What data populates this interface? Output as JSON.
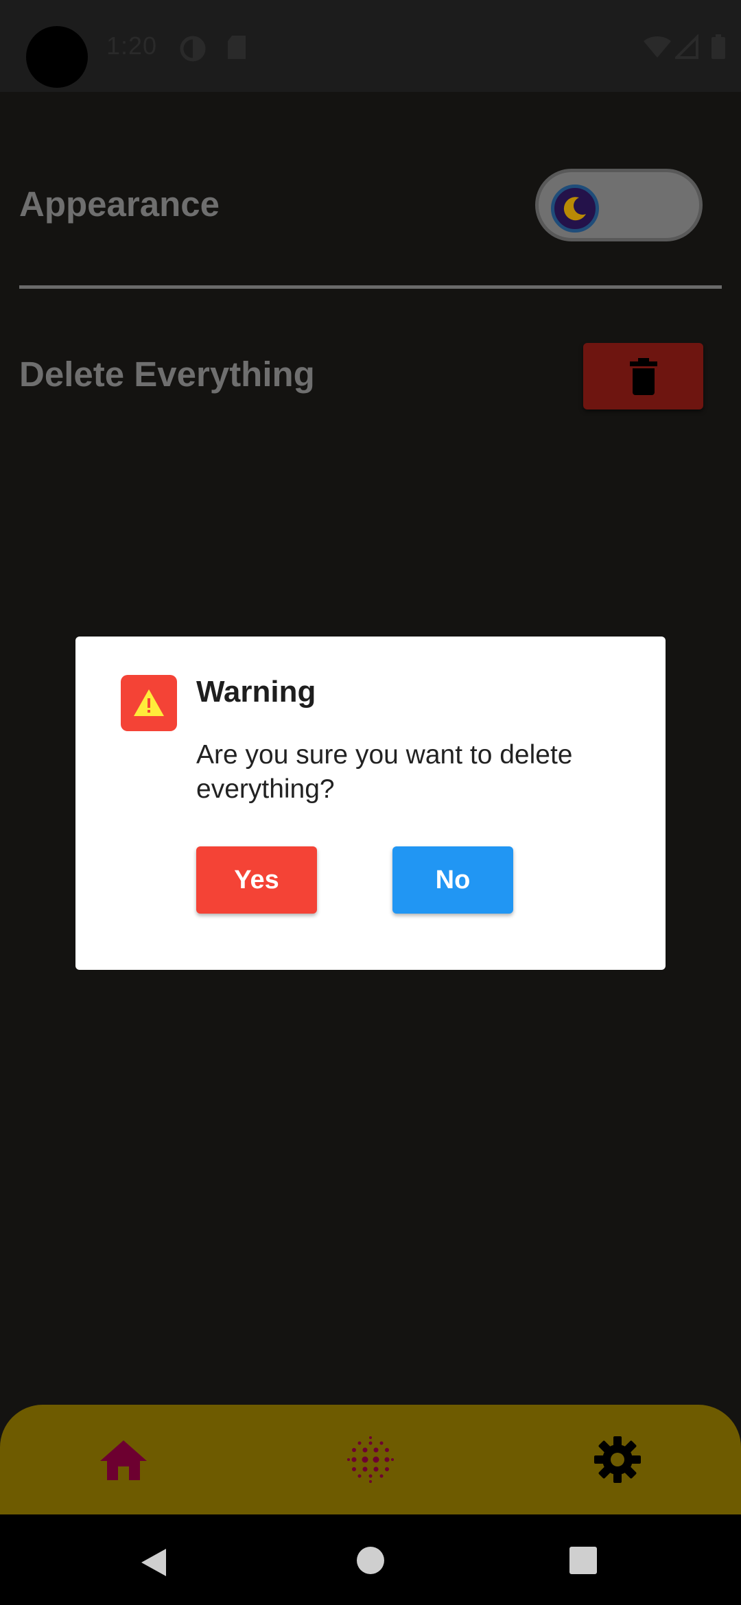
{
  "status_bar": {
    "time": "1:20"
  },
  "settings": {
    "appearance_label": "Appearance",
    "delete_label": "Delete Everything",
    "theme_toggle_icon": "moon-icon",
    "delete_button_icon": "trash-icon"
  },
  "dialog": {
    "icon": "warning-icon",
    "title": "Warning",
    "message": "Are you sure you want to delete everything?",
    "yes_label": "Yes",
    "no_label": "No"
  },
  "bottom_nav": {
    "items": [
      {
        "icon": "home-icon",
        "active": true
      },
      {
        "icon": "dots-grid-icon",
        "active": false
      },
      {
        "icon": "gear-icon",
        "active": false
      }
    ]
  },
  "colors": {
    "danger": "#f44336",
    "primary": "#2196f3",
    "nav_bar": "#6e5b00",
    "active_nav_icon": "#6d0030",
    "background": "#141311"
  }
}
